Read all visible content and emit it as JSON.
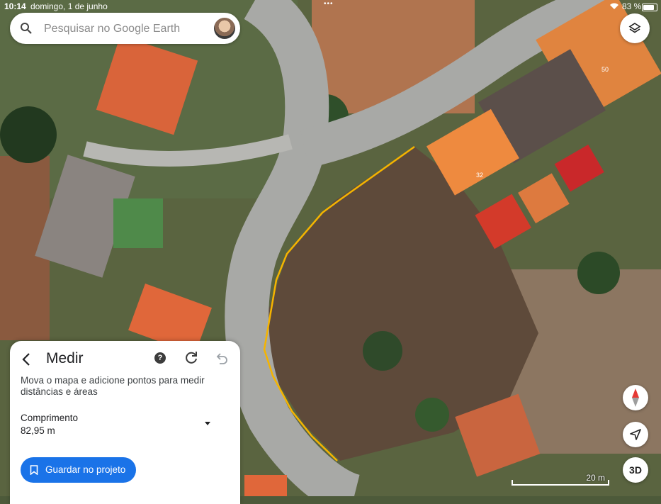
{
  "status_bar": {
    "time": "10:14",
    "date": "domingo, 1 de junho",
    "battery": "83 %"
  },
  "search": {
    "placeholder": "Pesquisar no Google Earth"
  },
  "map": {
    "house_numbers": [
      "50",
      "32"
    ],
    "scale_label": "20 m",
    "measure_line_color": "#f5b400"
  },
  "controls": {
    "three_d_label": "3D"
  },
  "measure_panel": {
    "title": "Medir",
    "description": "Mova o mapa e adicione pontos para medir distâncias e áreas",
    "length_label": "Comprimento",
    "length_value": "82,95 m",
    "save_button": "Guardar no projeto",
    "help_symbol": "?"
  },
  "colors": {
    "accent": "#1a73e8",
    "measure_line": "#f5b400"
  }
}
